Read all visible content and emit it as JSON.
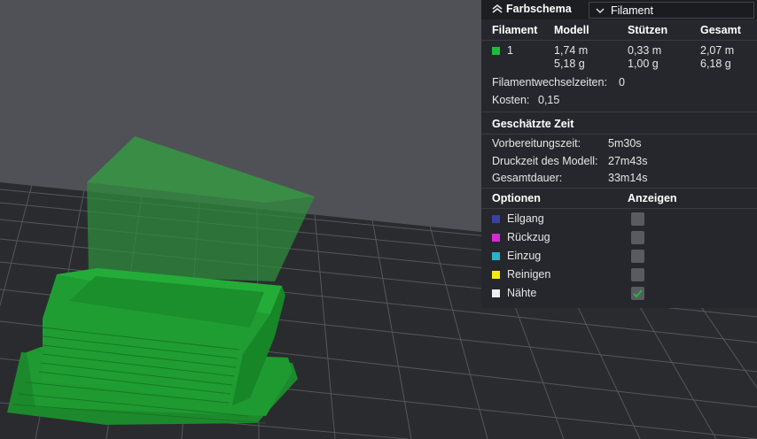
{
  "panel": {
    "title": "Farbschema",
    "dropdown_value": "Filament",
    "table_headers": [
      "Filament",
      "Modell",
      "Stützen",
      "Gesamt"
    ],
    "filament_rows": [
      {
        "id": "1",
        "color": "#1dbb3a",
        "modell": [
          "1,74 m",
          "5,18 g"
        ],
        "stuetzen": [
          "0,33 m",
          "1,00 g"
        ],
        "gesamt": [
          "2,07 m",
          "6,18 g"
        ]
      }
    ],
    "change_times_label": "Filamentwechselzeiten:",
    "change_times_value": "0",
    "cost_label": "Kosten:",
    "cost_value": "0,15",
    "time_section_title": "Geschätzte Zeit",
    "time_rows": [
      {
        "label": "Vorbereitungszeit:",
        "value": "5m30s"
      },
      {
        "label": "Druckzeit des Modell:",
        "value": "27m43s"
      },
      {
        "label": "Gesamtdauer:",
        "value": "33m14s"
      }
    ],
    "options_header": "Optionen",
    "show_header": "Anzeigen",
    "options": [
      {
        "label": "Eilgang",
        "color": "#3d3fa3",
        "checked": false
      },
      {
        "label": "Rückzug",
        "color": "#d52ad6",
        "checked": false
      },
      {
        "label": "Einzug",
        "color": "#2ab3c9",
        "checked": false
      },
      {
        "label": "Reinigen",
        "color": "#f2ea10",
        "checked": false
      },
      {
        "label": "Nähte",
        "color": "#ededed",
        "checked": true
      }
    ]
  }
}
